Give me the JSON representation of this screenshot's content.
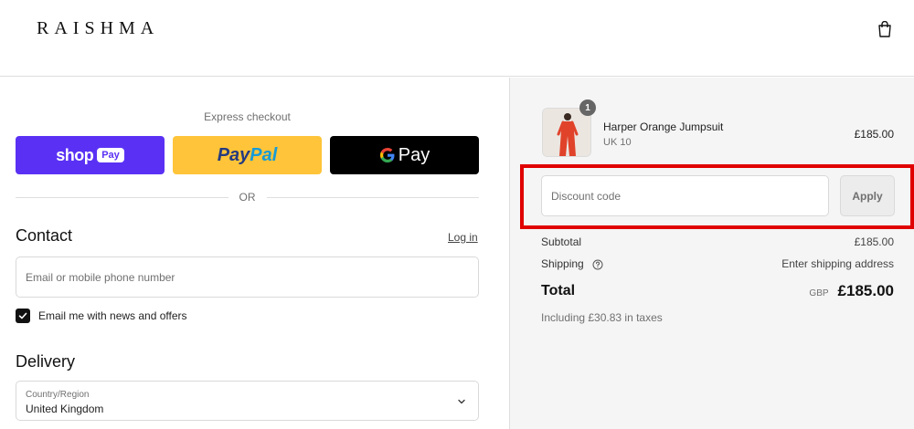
{
  "header": {
    "logo": "RAISHMA",
    "cart_icon": "shopping-bag-icon"
  },
  "express": {
    "label": "Express checkout",
    "shop_pay": {
      "text": "shop",
      "pill": "Pay",
      "color": "#5a31f4"
    },
    "paypal": {
      "part1": "Pay",
      "part2": "Pal",
      "color": "#ffc439"
    },
    "gpay": {
      "g": "G",
      "text": "Pay",
      "color": "#000000"
    },
    "or_text": "OR"
  },
  "contact": {
    "title": "Contact",
    "login_link": "Log in",
    "email_placeholder": "Email or mobile phone number",
    "newsletter_label": "Email me with news and offers",
    "newsletter_checked": true
  },
  "delivery": {
    "title": "Delivery",
    "country_label": "Country/Region",
    "country_value": "United Kingdom"
  },
  "order": {
    "product": {
      "name": "Harper Orange Jumpsuit",
      "variant": "UK 10",
      "price": "£185.00",
      "quantity": "1"
    },
    "discount": {
      "placeholder": "Discount code",
      "apply_label": "Apply"
    },
    "subtotal_label": "Subtotal",
    "subtotal_value": "£185.00",
    "shipping_label": "Shipping",
    "shipping_value": "Enter shipping address",
    "total_label": "Total",
    "total_currency": "GBP",
    "total_value": "£185.00",
    "taxes_text": "Including £30.83 in taxes"
  },
  "colors": {
    "highlight": "#e00000",
    "summary_bg": "#f5f5f5"
  }
}
